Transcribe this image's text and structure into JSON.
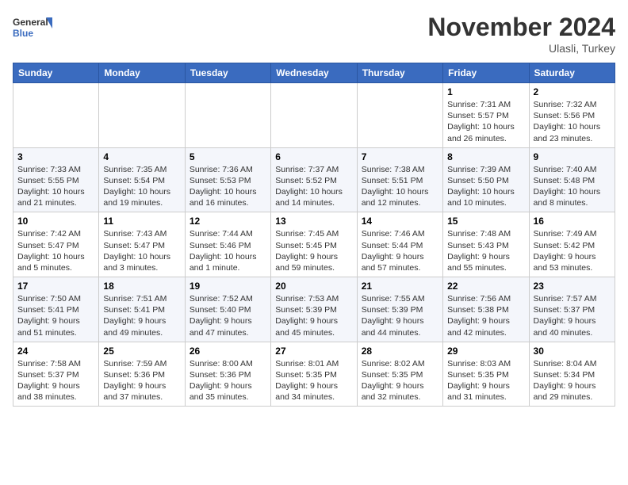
{
  "header": {
    "logo_general": "General",
    "logo_blue": "Blue",
    "month_title": "November 2024",
    "location": "Ulasli, Turkey"
  },
  "weekdays": [
    "Sunday",
    "Monday",
    "Tuesday",
    "Wednesday",
    "Thursday",
    "Friday",
    "Saturday"
  ],
  "weeks": [
    [
      {
        "day": "",
        "info": ""
      },
      {
        "day": "",
        "info": ""
      },
      {
        "day": "",
        "info": ""
      },
      {
        "day": "",
        "info": ""
      },
      {
        "day": "",
        "info": ""
      },
      {
        "day": "1",
        "info": "Sunrise: 7:31 AM\nSunset: 5:57 PM\nDaylight: 10 hours and 26 minutes."
      },
      {
        "day": "2",
        "info": "Sunrise: 7:32 AM\nSunset: 5:56 PM\nDaylight: 10 hours and 23 minutes."
      }
    ],
    [
      {
        "day": "3",
        "info": "Sunrise: 7:33 AM\nSunset: 5:55 PM\nDaylight: 10 hours and 21 minutes."
      },
      {
        "day": "4",
        "info": "Sunrise: 7:35 AM\nSunset: 5:54 PM\nDaylight: 10 hours and 19 minutes."
      },
      {
        "day": "5",
        "info": "Sunrise: 7:36 AM\nSunset: 5:53 PM\nDaylight: 10 hours and 16 minutes."
      },
      {
        "day": "6",
        "info": "Sunrise: 7:37 AM\nSunset: 5:52 PM\nDaylight: 10 hours and 14 minutes."
      },
      {
        "day": "7",
        "info": "Sunrise: 7:38 AM\nSunset: 5:51 PM\nDaylight: 10 hours and 12 minutes."
      },
      {
        "day": "8",
        "info": "Sunrise: 7:39 AM\nSunset: 5:50 PM\nDaylight: 10 hours and 10 minutes."
      },
      {
        "day": "9",
        "info": "Sunrise: 7:40 AM\nSunset: 5:48 PM\nDaylight: 10 hours and 8 minutes."
      }
    ],
    [
      {
        "day": "10",
        "info": "Sunrise: 7:42 AM\nSunset: 5:47 PM\nDaylight: 10 hours and 5 minutes."
      },
      {
        "day": "11",
        "info": "Sunrise: 7:43 AM\nSunset: 5:47 PM\nDaylight: 10 hours and 3 minutes."
      },
      {
        "day": "12",
        "info": "Sunrise: 7:44 AM\nSunset: 5:46 PM\nDaylight: 10 hours and 1 minute."
      },
      {
        "day": "13",
        "info": "Sunrise: 7:45 AM\nSunset: 5:45 PM\nDaylight: 9 hours and 59 minutes."
      },
      {
        "day": "14",
        "info": "Sunrise: 7:46 AM\nSunset: 5:44 PM\nDaylight: 9 hours and 57 minutes."
      },
      {
        "day": "15",
        "info": "Sunrise: 7:48 AM\nSunset: 5:43 PM\nDaylight: 9 hours and 55 minutes."
      },
      {
        "day": "16",
        "info": "Sunrise: 7:49 AM\nSunset: 5:42 PM\nDaylight: 9 hours and 53 minutes."
      }
    ],
    [
      {
        "day": "17",
        "info": "Sunrise: 7:50 AM\nSunset: 5:41 PM\nDaylight: 9 hours and 51 minutes."
      },
      {
        "day": "18",
        "info": "Sunrise: 7:51 AM\nSunset: 5:41 PM\nDaylight: 9 hours and 49 minutes."
      },
      {
        "day": "19",
        "info": "Sunrise: 7:52 AM\nSunset: 5:40 PM\nDaylight: 9 hours and 47 minutes."
      },
      {
        "day": "20",
        "info": "Sunrise: 7:53 AM\nSunset: 5:39 PM\nDaylight: 9 hours and 45 minutes."
      },
      {
        "day": "21",
        "info": "Sunrise: 7:55 AM\nSunset: 5:39 PM\nDaylight: 9 hours and 44 minutes."
      },
      {
        "day": "22",
        "info": "Sunrise: 7:56 AM\nSunset: 5:38 PM\nDaylight: 9 hours and 42 minutes."
      },
      {
        "day": "23",
        "info": "Sunrise: 7:57 AM\nSunset: 5:37 PM\nDaylight: 9 hours and 40 minutes."
      }
    ],
    [
      {
        "day": "24",
        "info": "Sunrise: 7:58 AM\nSunset: 5:37 PM\nDaylight: 9 hours and 38 minutes."
      },
      {
        "day": "25",
        "info": "Sunrise: 7:59 AM\nSunset: 5:36 PM\nDaylight: 9 hours and 37 minutes."
      },
      {
        "day": "26",
        "info": "Sunrise: 8:00 AM\nSunset: 5:36 PM\nDaylight: 9 hours and 35 minutes."
      },
      {
        "day": "27",
        "info": "Sunrise: 8:01 AM\nSunset: 5:35 PM\nDaylight: 9 hours and 34 minutes."
      },
      {
        "day": "28",
        "info": "Sunrise: 8:02 AM\nSunset: 5:35 PM\nDaylight: 9 hours and 32 minutes."
      },
      {
        "day": "29",
        "info": "Sunrise: 8:03 AM\nSunset: 5:35 PM\nDaylight: 9 hours and 31 minutes."
      },
      {
        "day": "30",
        "info": "Sunrise: 8:04 AM\nSunset: 5:34 PM\nDaylight: 9 hours and 29 minutes."
      }
    ]
  ]
}
